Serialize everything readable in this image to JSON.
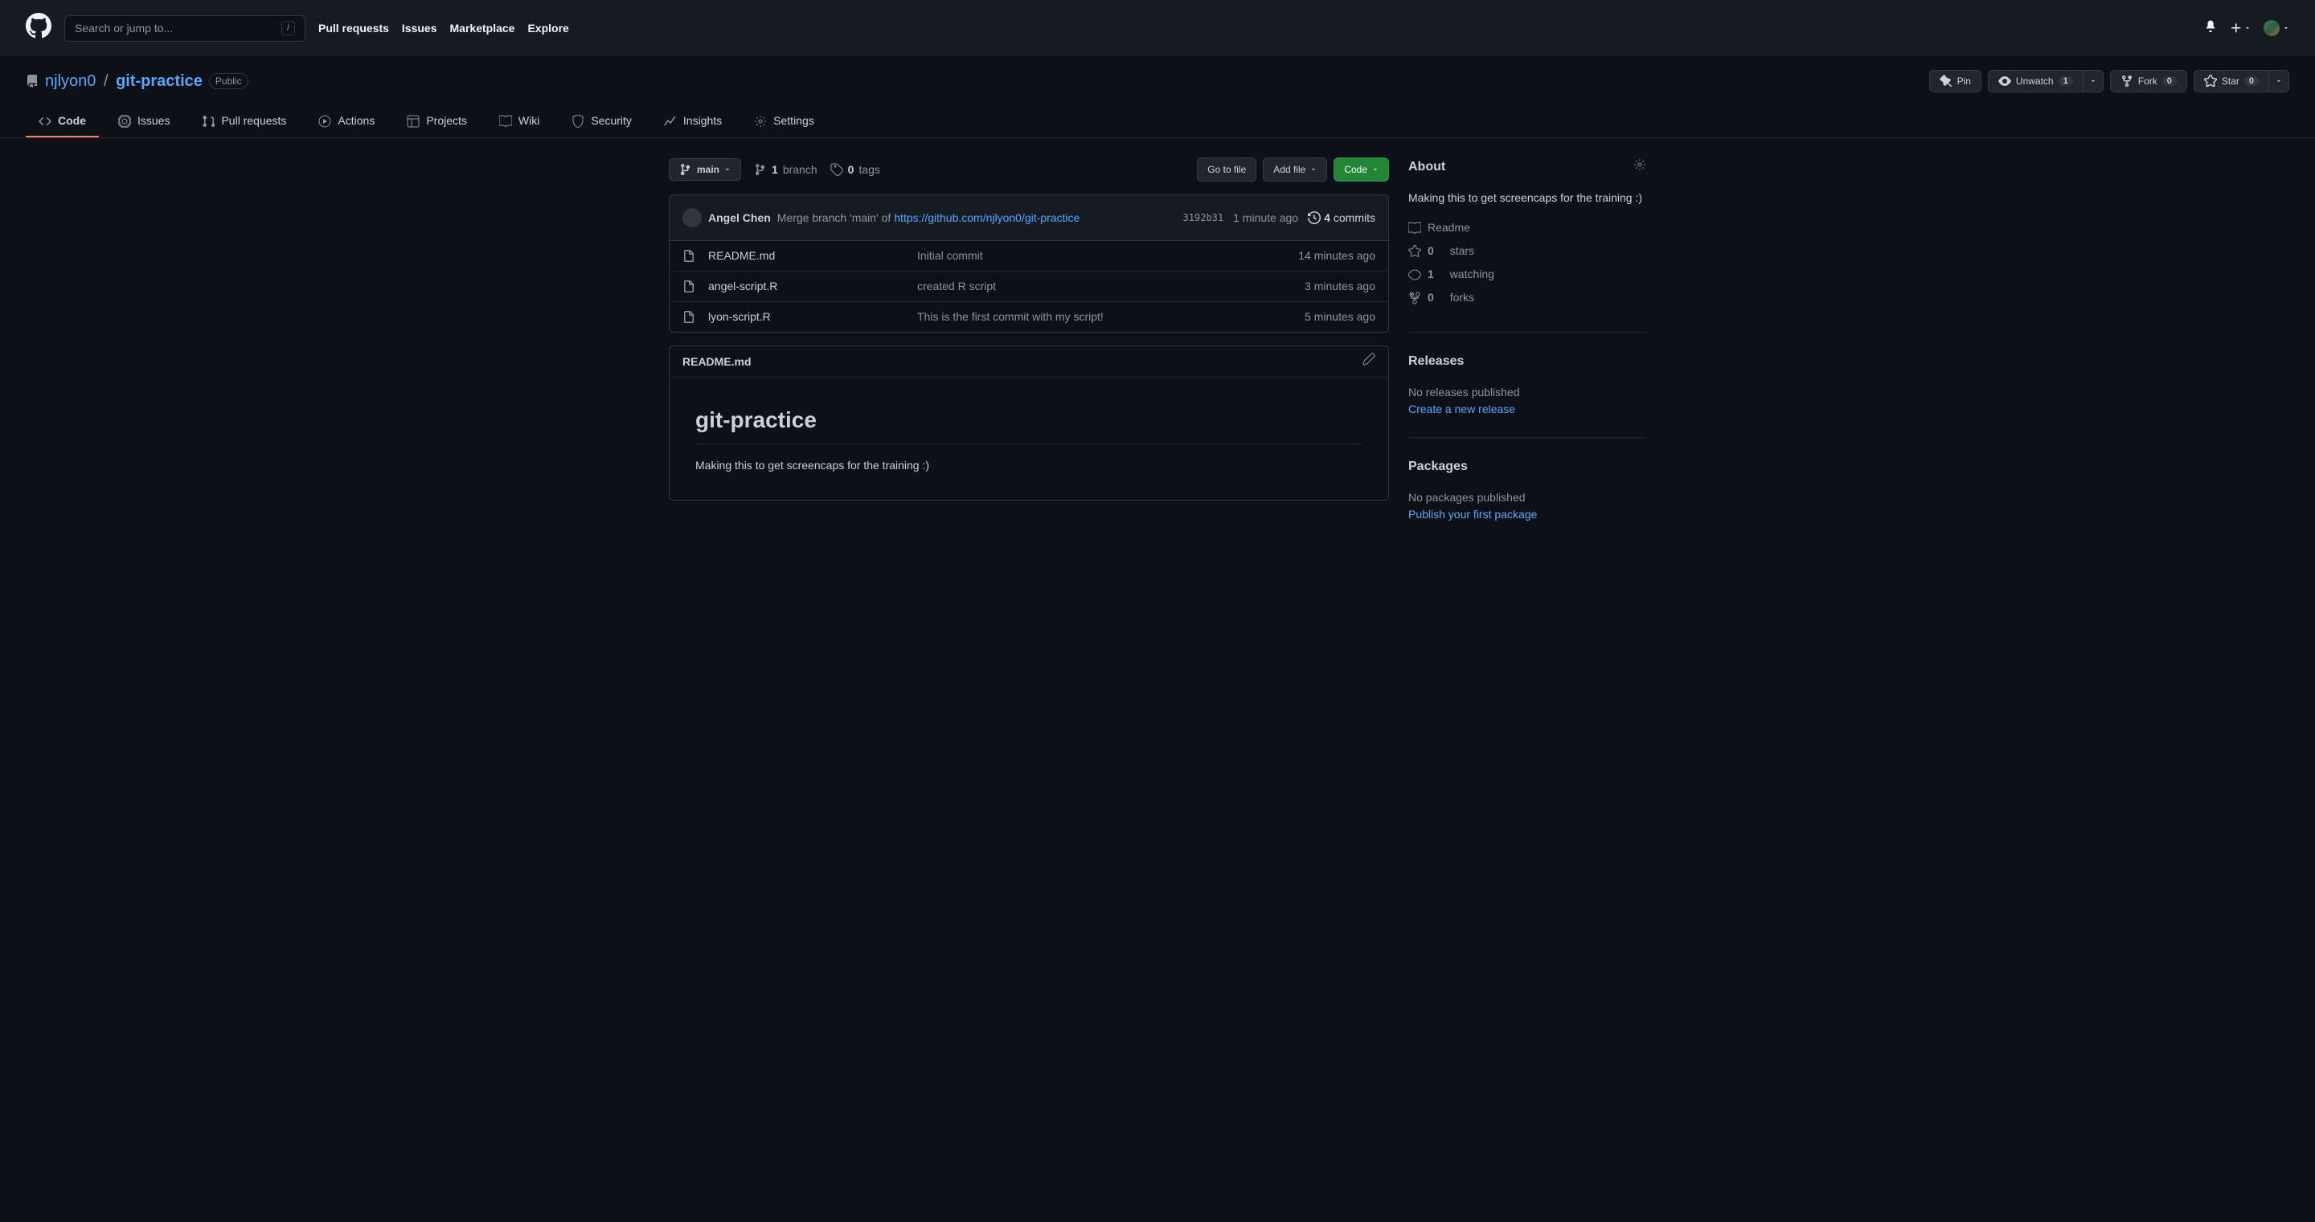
{
  "header": {
    "search_placeholder": "Search or jump to...",
    "search_kbd": "/",
    "nav": {
      "pull_requests": "Pull requests",
      "issues": "Issues",
      "marketplace": "Marketplace",
      "explore": "Explore"
    }
  },
  "repo": {
    "owner": "njlyon0",
    "name": "git-practice",
    "visibility": "Public",
    "actions": {
      "pin": "Pin",
      "unwatch": "Unwatch",
      "watch_count": "1",
      "fork": "Fork",
      "fork_count": "0",
      "star": "Star",
      "star_count": "0"
    }
  },
  "tabs": {
    "code": "Code",
    "issues": "Issues",
    "pull_requests": "Pull requests",
    "actions": "Actions",
    "projects": "Projects",
    "wiki": "Wiki",
    "security": "Security",
    "insights": "Insights",
    "settings": "Settings"
  },
  "file_nav": {
    "branch": "main",
    "branches_count": "1",
    "branches_label": "branch",
    "tags_count": "0",
    "tags_label": "tags",
    "go_to_file": "Go to file",
    "add_file": "Add file",
    "code_btn": "Code"
  },
  "commit": {
    "author": "Angel Chen",
    "msg_prefix": "Merge branch 'main' of ",
    "msg_link": "https://github.com/njlyon0/git-practice",
    "sha": "3192b31",
    "time": "1 minute ago",
    "count": "4",
    "count_label": "commits"
  },
  "files": [
    {
      "name": "README.md",
      "msg": "Initial commit",
      "time": "14 minutes ago"
    },
    {
      "name": "angel-script.R",
      "msg": "created R script",
      "time": "3 minutes ago"
    },
    {
      "name": "lyon-script.R",
      "msg": "This is the first commit with my script!",
      "time": "5 minutes ago"
    }
  ],
  "readme": {
    "filename": "README.md",
    "title": "git-practice",
    "body": "Making this to get screencaps for the training :)"
  },
  "about": {
    "heading": "About",
    "desc": "Making this to get screencaps for the training :)",
    "readme": "Readme",
    "stars_count": "0",
    "stars_label": "stars",
    "watching_count": "1",
    "watching_label": "watching",
    "forks_count": "0",
    "forks_label": "forks"
  },
  "releases": {
    "heading": "Releases",
    "empty": "No releases published",
    "link": "Create a new release"
  },
  "packages": {
    "heading": "Packages",
    "empty": "No packages published",
    "link": "Publish your first package"
  }
}
